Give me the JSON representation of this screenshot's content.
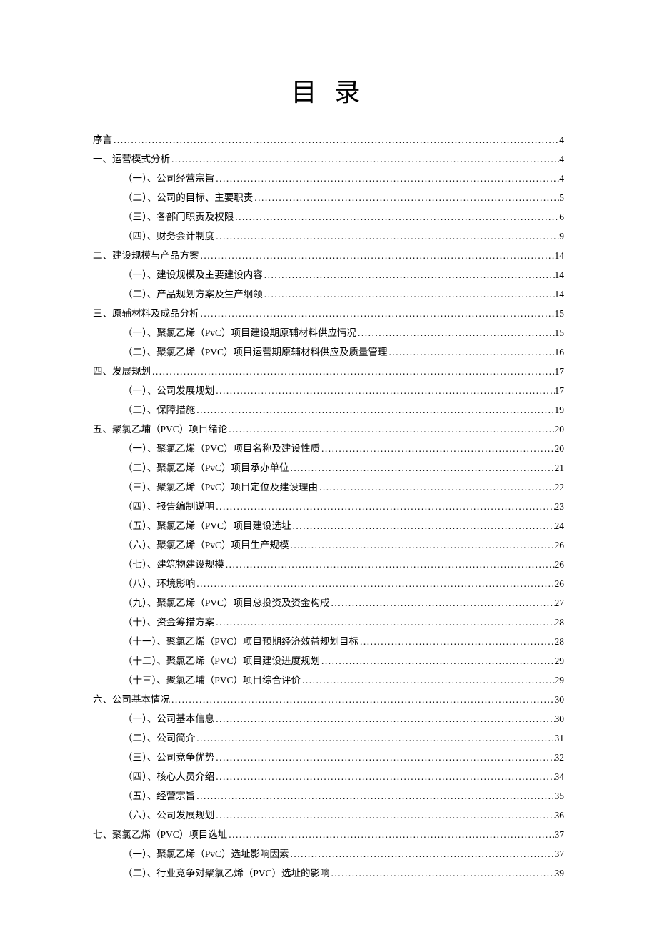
{
  "title": "目 录",
  "entries": [
    {
      "level": 1,
      "label": "序言",
      "page": "4"
    },
    {
      "level": 1,
      "label": "一、运营模式分析",
      "page": "4"
    },
    {
      "level": 2,
      "label": "（一）、公司经营宗旨",
      "page": "4"
    },
    {
      "level": 2,
      "label": "（二）、公司的目标、主要职责",
      "page": "5"
    },
    {
      "level": 2,
      "label": "（三）、各部门职责及权限",
      "page": "6"
    },
    {
      "level": 2,
      "label": "（四）、财务会计制度",
      "page": "9"
    },
    {
      "level": 1,
      "label": "二、建设规模与产品方案",
      "page": "14"
    },
    {
      "level": 2,
      "label": "（一）、建设规模及主要建设内容",
      "page": "14"
    },
    {
      "level": 2,
      "label": "（二）、产品规划方案及生产纲领",
      "page": "14"
    },
    {
      "level": 1,
      "label": "三、原辅材料及成品分析",
      "page": "15"
    },
    {
      "level": 2,
      "label": "（一）、聚氯乙烯（PvC）项目建设期原辅材料供应情况",
      "page": "15"
    },
    {
      "level": 2,
      "label": "（二）、聚氯乙烯（PVC）项目运营期原辅材料供应及质量管理",
      "page": "16"
    },
    {
      "level": 1,
      "label": "四、发展规划",
      "page": "17"
    },
    {
      "level": 2,
      "label": "（一）、公司发展规划",
      "page": "17"
    },
    {
      "level": 2,
      "label": "（二）、保障措施",
      "page": "19"
    },
    {
      "level": 1,
      "label": "五、聚氯乙埔（PVC）项目绪论",
      "page": "20"
    },
    {
      "level": 2,
      "label": "（一）、聚氯乙烯（PVC）项目名称及建设性质",
      "page": "20"
    },
    {
      "level": 2,
      "label": "（二）、聚氯乙烯（PvC）项目承办单位",
      "page": "21"
    },
    {
      "level": 2,
      "label": "（三）、聚氯乙烯（PvC）项目定位及建设理由",
      "page": "22"
    },
    {
      "level": 2,
      "label": "（四）、报告编制说明",
      "page": "23"
    },
    {
      "level": 2,
      "label": "（五）、聚氯乙烯（PVC）项目建设选址",
      "page": "24"
    },
    {
      "level": 2,
      "label": "（六）、聚氯乙烯（PvC）项目生产规模",
      "page": "26"
    },
    {
      "level": 2,
      "label": "（七）、建筑物建设规模",
      "page": "26"
    },
    {
      "level": 2,
      "label": "（八）、环境影响",
      "page": "26"
    },
    {
      "level": 2,
      "label": "（九）、聚氯乙烯（PVC）项目总投资及资金构成",
      "page": "27"
    },
    {
      "level": 2,
      "label": "（十）、资金筹措方案",
      "page": "28"
    },
    {
      "level": 2,
      "label": "（十一）、聚氯乙烯（PVC）项目预期经济效益规划目标",
      "page": "28"
    },
    {
      "level": 2,
      "label": "（十二）、聚氯乙烯（PVC）项目建设进度规划",
      "page": "29"
    },
    {
      "level": 2,
      "label": "（十三）、聚氯乙埔（PVC）项目综合评价",
      "page": "29"
    },
    {
      "level": 1,
      "label": "六、公司基本情况",
      "page": "30"
    },
    {
      "level": 2,
      "label": "（一）、公司基本信息",
      "page": "30"
    },
    {
      "level": 2,
      "label": "（二）、公司简介",
      "page": "31"
    },
    {
      "level": 2,
      "label": "（三）、公司竞争优势",
      "page": "32"
    },
    {
      "level": 2,
      "label": "（四）、核心人员介绍",
      "page": "34"
    },
    {
      "level": 2,
      "label": "（五）、经营宗旨",
      "page": "35"
    },
    {
      "level": 2,
      "label": "（六）、公司发展规划",
      "page": "36"
    },
    {
      "level": 1,
      "label": "七、聚氯乙烯（PVC）项目选址",
      "page": "37"
    },
    {
      "level": 2,
      "label": "（一）、聚氯乙烯（PvC）选址影响因素",
      "page": "37"
    },
    {
      "level": 2,
      "label": "（二）、行业竞争对聚氯乙烯（PVC）选址的影响",
      "page": "39"
    }
  ]
}
